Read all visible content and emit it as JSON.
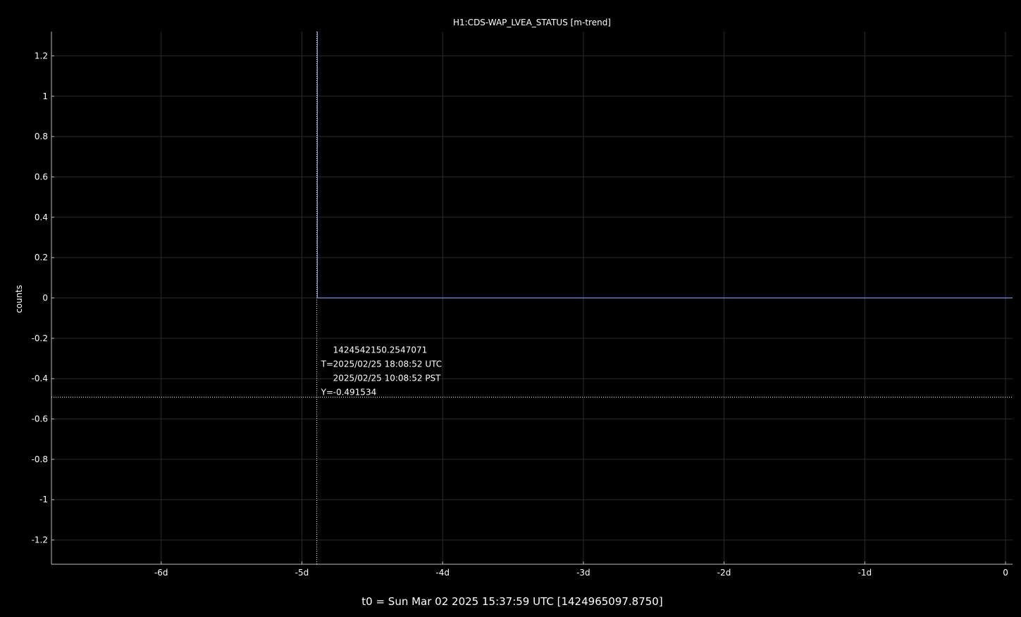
{
  "chart_data": {
    "type": "line",
    "title": "H1:CDS-WAP_LVEA_STATUS [m-trend]",
    "xlabel": "t0 = Sun Mar 02 2025 15:37:59 UTC [1424965097.8750]",
    "ylabel": "counts",
    "x_unit": "days relative to t0",
    "xlim": [
      -6.78,
      0.05
    ],
    "ylim": [
      -1.32,
      1.32
    ],
    "x_ticks": [
      -6,
      -5,
      -4,
      -3,
      -2,
      -1,
      0
    ],
    "x_tick_labels": [
      "-6d",
      "-5d",
      "-4d",
      "-3d",
      "-2d",
      "-1d",
      "0"
    ],
    "y_ticks": [
      -1.2,
      -1,
      -0.8,
      -0.6,
      -0.4,
      -0.2,
      0,
      0.2,
      0.4,
      0.6,
      0.8,
      1,
      1.2
    ],
    "y_tick_labels": [
      "-1.2",
      "-1",
      "-0.8",
      "-0.6",
      "-0.4",
      "-0.2",
      "0",
      "0.2",
      "0.4",
      "0.6",
      "0.8",
      "1",
      "1.2"
    ],
    "grid": true,
    "series": [
      {
        "color": "#7b8ee0",
        "x": [
          -4.89,
          -4.89,
          0.05
        ],
        "y": [
          1.32,
          0,
          0
        ]
      }
    ],
    "cursor": {
      "x": -4.8941,
      "y": -0.491534,
      "lines": [
        {
          "prefix": "",
          "text": "1424542150.2547071"
        },
        {
          "prefix": "T=",
          "text": "2025/02/25 18:08:52 UTC"
        },
        {
          "prefix": "",
          "text": "2025/02/25 10:08:52 PST"
        },
        {
          "prefix": "Y=",
          "text": "-0.491534"
        }
      ]
    },
    "colors": {
      "background": "#000000",
      "grid": "#2a2a2a",
      "axis": "#bbbbbb",
      "cursor": "#ffffff"
    }
  }
}
